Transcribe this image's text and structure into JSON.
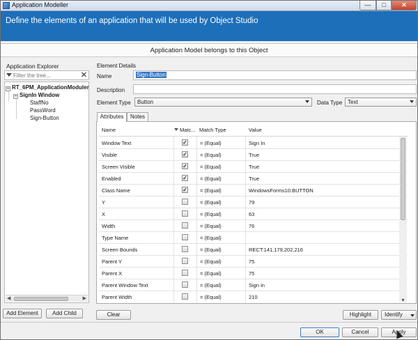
{
  "window": {
    "title": "Application Modeller",
    "controls": {
      "minimize": "—",
      "maximize": "□",
      "close": "✕"
    }
  },
  "banner": {
    "text": "Define the elements of an application that will be used by Object Studio"
  },
  "object_bar": {
    "text": "Application Model belongs to this Object"
  },
  "explorer": {
    "title": "Application Explorer",
    "filter_placeholder": "Filter the tree...",
    "tree": {
      "root": {
        "toggle": "−",
        "label": "RT_6PM_ApplicationModuler"
      },
      "window": {
        "toggle": "−",
        "label": "SignIn Window"
      },
      "elements": [
        {
          "label": "StaffNo"
        },
        {
          "label": "PassWord"
        },
        {
          "label": "Sign-Button"
        }
      ]
    },
    "add_element": "Add Element",
    "add_child": "Add Child"
  },
  "details": {
    "section_title": "Element Details",
    "name_label": "Name",
    "name_value": "Sign-Button",
    "description_label": "Description",
    "description_value": "",
    "element_type_label": "Element Type",
    "element_type_value": "Button",
    "data_type_label": "Data Type",
    "data_type_value": "Text"
  },
  "tabs": [
    {
      "label": "Attributes",
      "active": true
    },
    {
      "label": "Notes",
      "active": false
    }
  ],
  "attributes": {
    "columns": {
      "name": "Name",
      "match": "Matc...",
      "match_type": "Match Type",
      "value": "Value"
    },
    "rows": [
      {
        "name": "Window Text",
        "checked": true,
        "match_type": "= (Equal)",
        "value": "Sign In"
      },
      {
        "name": "Visible",
        "checked": true,
        "match_type": "= (Equal)",
        "value": "True"
      },
      {
        "name": "Screen Visible",
        "checked": true,
        "match_type": "= (Equal)",
        "value": "True"
      },
      {
        "name": "Enabled",
        "checked": true,
        "match_type": "= (Equal)",
        "value": "True"
      },
      {
        "name": "Class Name",
        "checked": true,
        "match_type": "= (Equal)",
        "value": "WindowsForms10.BUTTON"
      },
      {
        "name": "Y",
        "checked": false,
        "match_type": "= (Equal)",
        "value": "79"
      },
      {
        "name": "X",
        "checked": false,
        "match_type": "= (Equal)",
        "value": "63"
      },
      {
        "name": "Width",
        "checked": false,
        "match_type": "= (Equal)",
        "value": "76"
      },
      {
        "name": "Type Name",
        "checked": false,
        "match_type": "= (Equal)",
        "value": ""
      },
      {
        "name": "Screen Bounds",
        "checked": false,
        "match_type": "= (Equal)",
        "value": "RECT:141,179,202,216"
      },
      {
        "name": "Parent Y",
        "checked": false,
        "match_type": "= (Equal)",
        "value": "75"
      },
      {
        "name": "Parent X",
        "checked": false,
        "match_type": "= (Equal)",
        "value": "75"
      },
      {
        "name": "Parent Window Text",
        "checked": false,
        "match_type": "= (Equal)",
        "value": "Sign in"
      },
      {
        "name": "Parent Width",
        "checked": false,
        "match_type": "= (Equal)",
        "value": "210"
      }
    ]
  },
  "buttons": {
    "clear": "Clear",
    "highlight": "Highlight",
    "identify": "Identify",
    "ok": "OK",
    "cancel": "Cancel",
    "apply": "Apply"
  },
  "colors": {
    "banner": "#1d6fb9",
    "selection": "#3476c3"
  }
}
